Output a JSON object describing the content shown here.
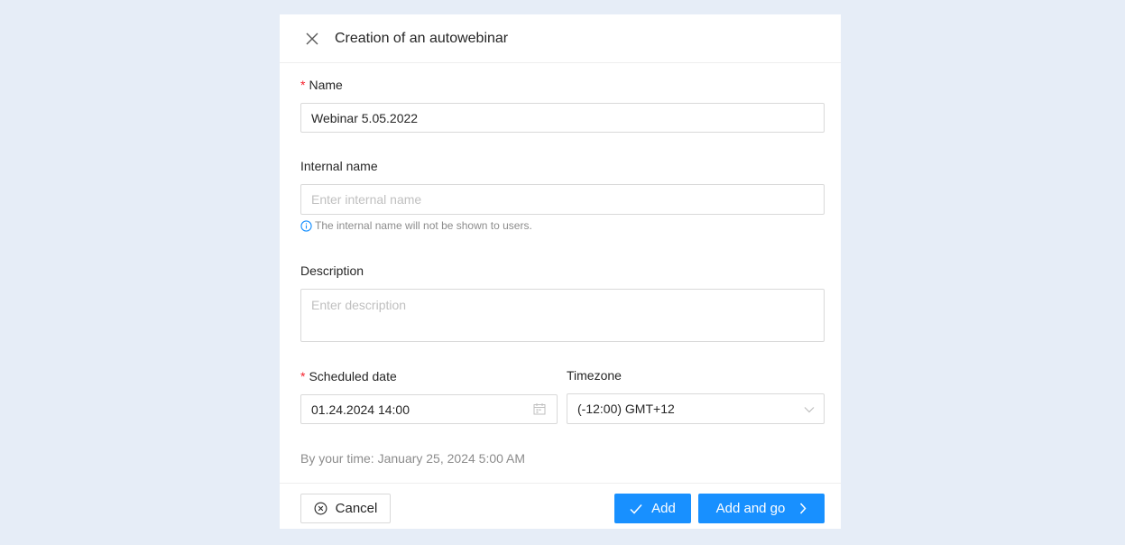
{
  "modal": {
    "title": "Creation of an autowebinar"
  },
  "form": {
    "name": {
      "label": "Name",
      "required_mark": "*",
      "value": "Webinar 5.05.2022"
    },
    "internal_name": {
      "label": "Internal name",
      "placeholder": "Enter internal name",
      "hint": "The internal name will not be shown to users."
    },
    "description": {
      "label": "Description",
      "placeholder": "Enter description"
    },
    "scheduled_date": {
      "label": "Scheduled date",
      "required_mark": "*",
      "value": "01.24.2024 14:00"
    },
    "timezone": {
      "label": "Timezone",
      "value": "(-12:00) GMT+12"
    },
    "by_your_time": "By your time: January 25, 2024 5:00 AM"
  },
  "footer": {
    "cancel_label": "Cancel",
    "add_label": "Add",
    "add_and_go_label": "Add and go"
  },
  "colors": {
    "primary": "#1890ff",
    "required": "#f5222d",
    "background": "#e6edf7"
  },
  "icons": {
    "close": "close-icon",
    "info": "info-icon",
    "calendar": "calendar-icon",
    "dropdown": "chevron-down-icon",
    "cancel": "close-circle-icon",
    "add": "check-icon",
    "add_and_go": "chevron-right-icon"
  }
}
